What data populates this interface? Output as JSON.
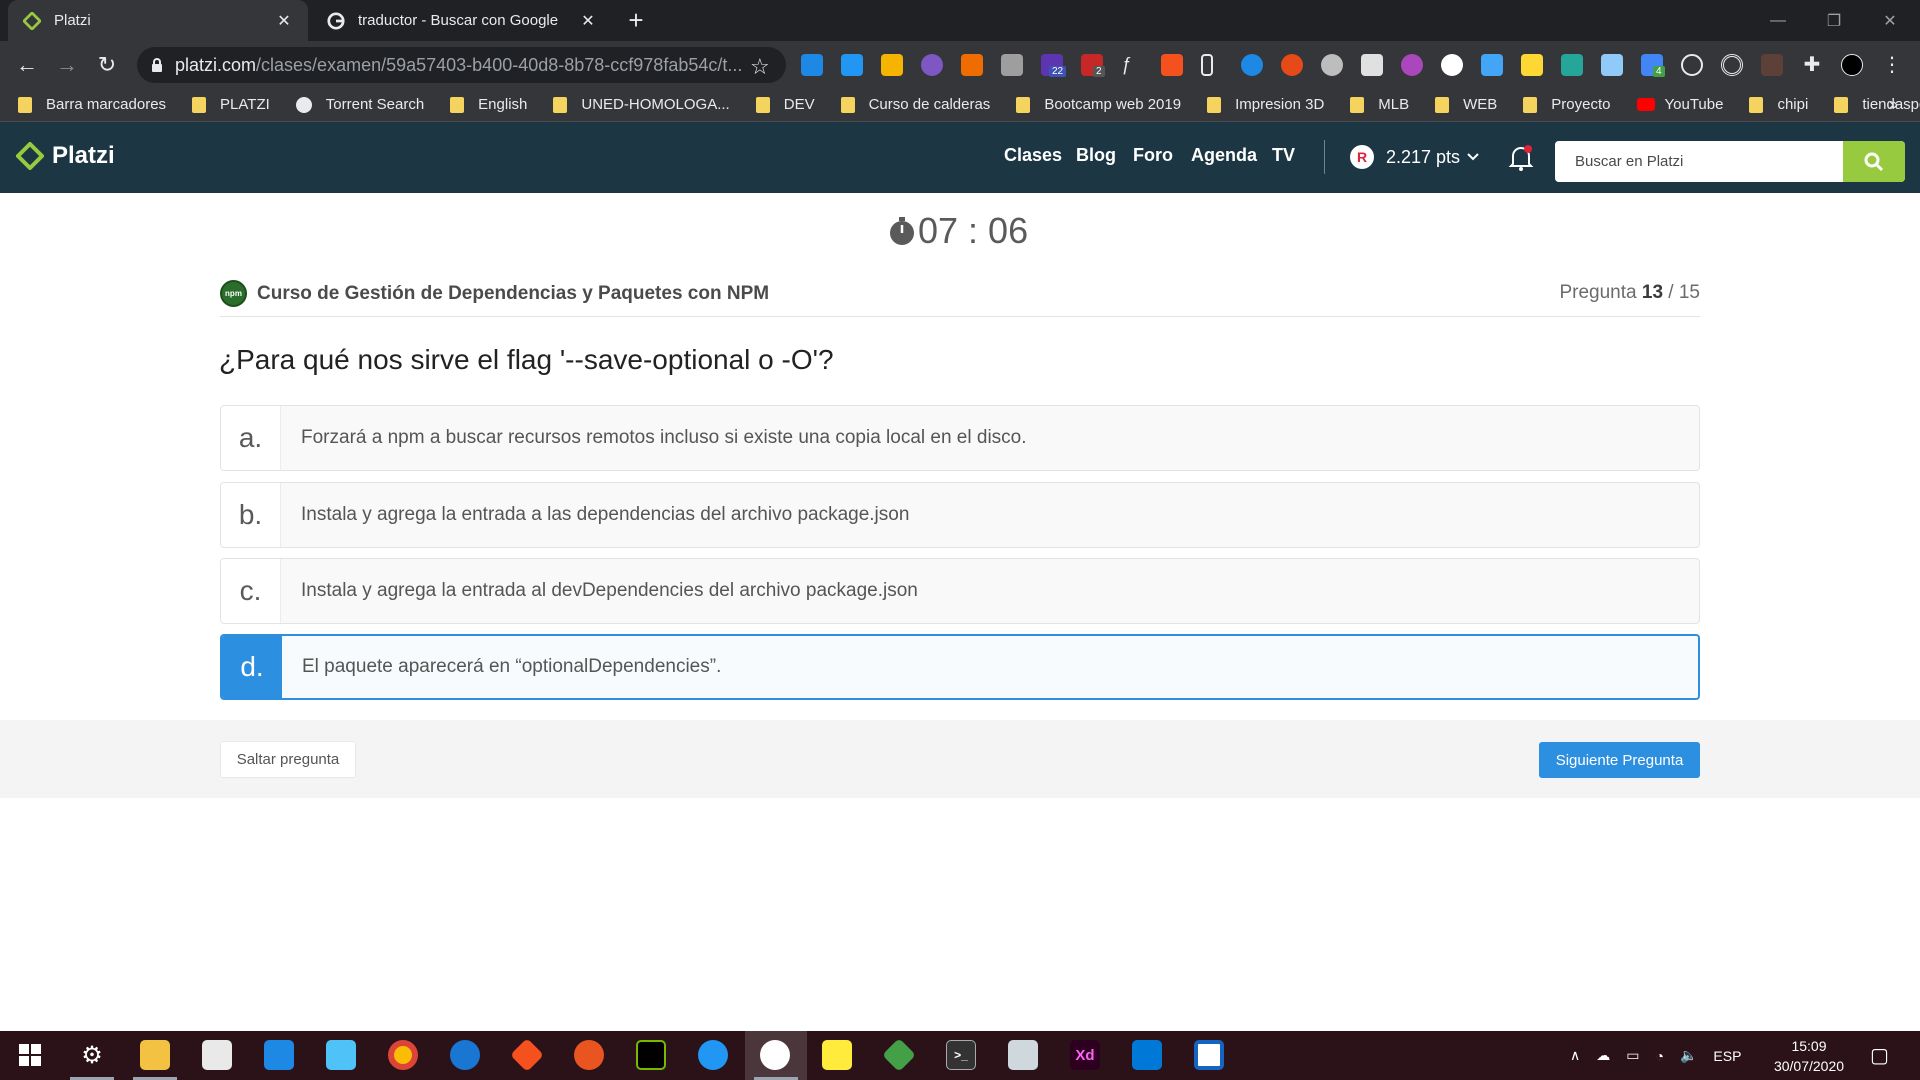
{
  "browser": {
    "tabs": [
      {
        "title": "Platzi",
        "close": "✕"
      },
      {
        "title": "traductor - Buscar con Google",
        "close": "✕"
      }
    ],
    "new_tab": "+",
    "url_domain": "platzi.com",
    "url_path": "/clases/examen/59a57403-b400-40d8-8b78-ccf978fab54c/t...",
    "bookmarks": [
      {
        "label": "Barra marcadores",
        "icon": "folder-icon"
      },
      {
        "label": "PLATZI",
        "icon": "folder-icon"
      },
      {
        "label": "Torrent Search",
        "icon": "globe-icon"
      },
      {
        "label": "English",
        "icon": "folder-icon"
      },
      {
        "label": "UNED-HOMOLOGA...",
        "icon": "folder-icon"
      },
      {
        "label": "DEV",
        "icon": "folder-icon"
      },
      {
        "label": "Curso de calderas",
        "icon": "folder-icon"
      },
      {
        "label": "Bootcamp web 2019",
        "icon": "folder-icon"
      },
      {
        "label": "Impresion 3D",
        "icon": "folder-icon"
      },
      {
        "label": "MLB",
        "icon": "folder-icon"
      },
      {
        "label": "WEB",
        "icon": "folder-icon"
      },
      {
        "label": "Proyecto",
        "icon": "folder-icon"
      },
      {
        "label": "YouTube",
        "icon": "youtube-icon"
      },
      {
        "label": "chipi",
        "icon": "folder-icon"
      },
      {
        "label": "tiendaspc",
        "icon": "folder-icon"
      }
    ],
    "bookmarks_more": "»",
    "extension_badges": {
      "ext5": "22",
      "ext6": "2",
      "ext20": "4"
    }
  },
  "platzi": {
    "logo_text": "Platzi",
    "nav": [
      "Clases",
      "Blog",
      "Foro",
      "Agenda",
      "TV"
    ],
    "points": "2.217 pts",
    "search_placeholder": "Buscar en Platzi",
    "colors": {
      "header": "#1c3643",
      "search_button": "#98ca3f",
      "accent": "#2d8fe0"
    }
  },
  "exam": {
    "timer": "07 : 06",
    "course_title": "Curso de Gestión de Dependencias y Paquetes con NPM",
    "course_logo_text": "npm",
    "question_label": "Pregunta",
    "question_current": "13",
    "question_total": "/ 15",
    "question": "¿Para qué nos sirve el flag '--save-optional o -O'?",
    "options": [
      {
        "letter": "a.",
        "text": "Forzará a npm a buscar recursos remotos incluso si existe una copia local en el disco.",
        "selected": false
      },
      {
        "letter": "b.",
        "text": "Instala y agrega la entrada a las dependencias del archivo package.json",
        "selected": false
      },
      {
        "letter": "c.",
        "text": "Instala y agrega la entrada al devDependencies del archivo package.json",
        "selected": false
      },
      {
        "letter": "d.",
        "text": "El paquete aparecerá en “optionalDependencies”.",
        "selected": true
      }
    ],
    "skip_label": "Saltar pregunta",
    "next_label": "Siguiente Pregunta"
  },
  "taskbar": {
    "language": "ESP",
    "time": "15:09",
    "date": "30/07/2020",
    "apps": [
      "windows-start-icon",
      "settings-icon",
      "file-explorer-icon",
      "store-icon",
      "mail-icon",
      "control-panel-icon",
      "chrome-icon",
      "firefox-icon",
      "git-icon",
      "ubuntu-icon",
      "nvidia-icon",
      "app-icon",
      "remote-desktop-icon",
      "sticky-notes-icon",
      "gitkraken-icon",
      "terminal-icon",
      "media-player-icon",
      "adobe-xd-icon",
      "vscode-icon",
      "jw-icon"
    ],
    "xd_label": "Xd"
  }
}
